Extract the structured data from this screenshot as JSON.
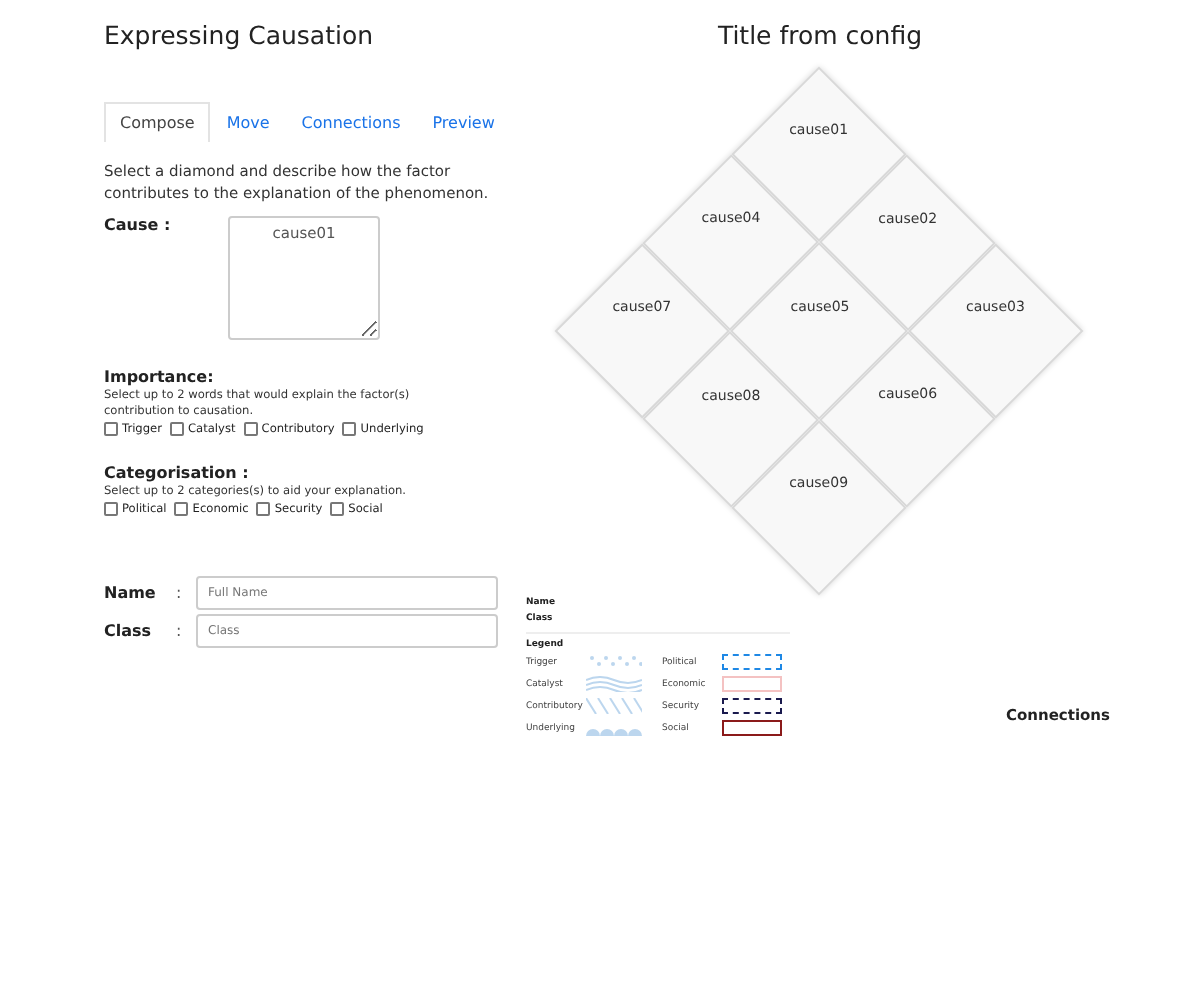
{
  "left_title": "Expressing Causation",
  "tabs": [
    {
      "label": "Compose",
      "selected": true
    },
    {
      "label": "Move",
      "selected": false
    },
    {
      "label": "Connections",
      "selected": false
    },
    {
      "label": "Preview",
      "selected": false
    }
  ],
  "instructions": "Select a diamond and describe how the factor contributes to the explanation of the phenomenon.",
  "cause": {
    "label": "Cause :",
    "value": "cause01"
  },
  "importance": {
    "heading": "Importance:",
    "hint": "Select up to 2 words that would explain the factor(s) contribution to causation.",
    "options": [
      {
        "label": "Trigger",
        "checked": false
      },
      {
        "label": "Catalyst",
        "checked": false
      },
      {
        "label": "Contributory",
        "checked": false
      },
      {
        "label": "Underlying",
        "checked": false
      }
    ]
  },
  "categorisation": {
    "heading": "Categorisation :",
    "hint": "Select up to 2 categories(s) to aid your explanation.",
    "options": [
      {
        "label": "Political",
        "checked": false
      },
      {
        "label": "Economic",
        "checked": false
      },
      {
        "label": "Security",
        "checked": false
      },
      {
        "label": "Social",
        "checked": false
      }
    ]
  },
  "fields": [
    {
      "label": "Name",
      "separator": ":",
      "placeholder": "Full Name"
    },
    {
      "label": "Class",
      "separator": ":",
      "placeholder": "Class"
    }
  ],
  "right_title": "Title from config",
  "diamonds": [
    "cause01",
    "cause02",
    "cause03",
    "cause04",
    "cause05",
    "cause06",
    "cause07",
    "cause08",
    "cause09"
  ],
  "legend": {
    "name": "Name",
    "class": "Class",
    "heading": "Legend",
    "importance": [
      {
        "label": "Trigger",
        "kind": "dots"
      },
      {
        "label": "Catalyst",
        "kind": "waves"
      },
      {
        "label": "Contributory",
        "kind": "stripes"
      },
      {
        "label": "Underlying",
        "kind": "scallops"
      }
    ],
    "categories": [
      {
        "label": "Political",
        "color": "#1e88e5",
        "kind": "dashed"
      },
      {
        "label": "Economic",
        "color": "#f4c2c2",
        "kind": "solid"
      },
      {
        "label": "Security",
        "color": "#1a1a4e",
        "kind": "dashed"
      },
      {
        "label": "Social",
        "color": "#8b1a1a",
        "kind": "solid"
      }
    ]
  },
  "connections_label": "Connections"
}
